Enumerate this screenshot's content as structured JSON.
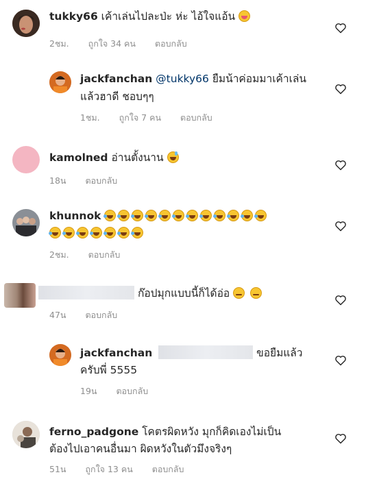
{
  "comments": [
    {
      "username": "tukky66",
      "text": "เค้าเล่นไปละป่ะ ห่ะ ไอ้ใจแอ้น",
      "emoji": [
        "zany-face"
      ],
      "time": "2ชม.",
      "likes": "ถูกใจ 34 คน",
      "reply": "ตอบกลับ"
    },
    {
      "username": "jackfanchan",
      "mention": "@tukky66",
      "text_line1": "ยืมน้าค่อมมาเค้าเล่น",
      "text_line2": "แล้วฮาดี ชอบๆๆ",
      "time": "1ชม.",
      "likes": "ถูกใจ 7 คน",
      "reply": "ตอบกลับ"
    },
    {
      "username": "kamolned",
      "text": "อ่านตั้งนาน",
      "emoji": [
        "grinning-sweat-face"
      ],
      "time": "18น",
      "reply": "ตอบกลับ"
    },
    {
      "username": "khunnok",
      "emoji_line1_count": 12,
      "emoji_line2_count": 7,
      "emoji": "rolling-on-floor-laughing-face",
      "time": "2ชม.",
      "reply": "ตอบกลับ"
    },
    {
      "username": "",
      "text": "ก๊อปมุกแบบนี้ก็ได้อ่อ",
      "emoji": [
        "unamused-face",
        "relieved-face"
      ],
      "time": "47น",
      "reply": "ตอบกลับ"
    },
    {
      "username": "jackfanchan",
      "text_line1": "ขอยืมแล้ว",
      "text_line2": "ครับพี่ 5555",
      "time": "19น",
      "reply": "ตอบกลับ"
    },
    {
      "username": "ferno_padgone",
      "text_line1": "โคตรผิดหวัง มุกก็คิดเองไม่เป็น",
      "text_line2": "ต้องไปเอาคนอื่นมา ผิดหวังในตัวมึงจริงๆ",
      "time": "51น",
      "likes": "ถูกใจ 13 คน",
      "reply": "ตอบกลับ"
    }
  ],
  "colors": {
    "text": "#262626",
    "meta": "#8e8e8e",
    "mention": "#003569",
    "kamolned_avatar": "#f4b6c2"
  }
}
